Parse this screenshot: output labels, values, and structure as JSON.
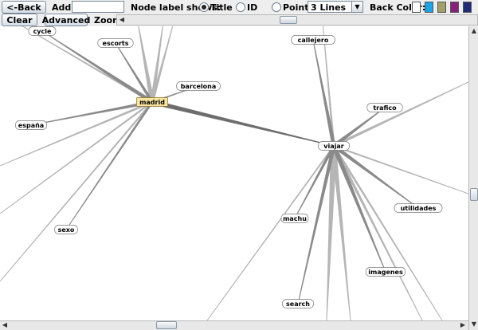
{
  "toolbar": {
    "back_label": "<-Back",
    "add_label": "Add",
    "add_value": "",
    "node_label_shows": "Node label shows:",
    "radio_title": "Title",
    "radio_id": "ID",
    "radio_point": "Point",
    "selected_radio": "Title",
    "lines_select_value": "3 Lines",
    "back_color_label": "Back Color:",
    "back_colors": [
      "#ffffff",
      "#19a5e6",
      "#a4a06a",
      "#8b1e7a",
      "#1f2a78"
    ],
    "clear_label": "Clear",
    "advanced_label": "Advanced",
    "zoom_label": "Zoom"
  },
  "graph": {
    "nodes": [
      {
        "id": "cycle",
        "label": "cycle"
      },
      {
        "id": "escorts",
        "label": "escorts"
      },
      {
        "id": "barcelona",
        "label": "barcelona"
      },
      {
        "id": "madrid",
        "label": "madrid",
        "selected": true
      },
      {
        "id": "espana",
        "label": "españa"
      },
      {
        "id": "sexo",
        "label": "sexo"
      },
      {
        "id": "callejero",
        "label": "callejero"
      },
      {
        "id": "trafico",
        "label": "trafico"
      },
      {
        "id": "viajar",
        "label": "viajar"
      },
      {
        "id": "utilidades",
        "label": "utilidades"
      },
      {
        "id": "machu",
        "label": "machu"
      },
      {
        "id": "imagenes",
        "label": "imagenes"
      },
      {
        "id": "search",
        "label": "search"
      }
    ],
    "edges": [
      [
        "madrid",
        "viajar"
      ],
      [
        "madrid",
        "barcelona"
      ],
      [
        "madrid",
        "escorts"
      ],
      [
        "madrid",
        "cycle"
      ],
      [
        "madrid",
        "espana"
      ],
      [
        "madrid",
        "sexo"
      ],
      [
        "viajar",
        "callejero"
      ],
      [
        "viajar",
        "trafico"
      ],
      [
        "viajar",
        "machu"
      ],
      [
        "viajar",
        "utilidades"
      ],
      [
        "viajar",
        "imagenes"
      ],
      [
        "viajar",
        "search"
      ]
    ]
  }
}
